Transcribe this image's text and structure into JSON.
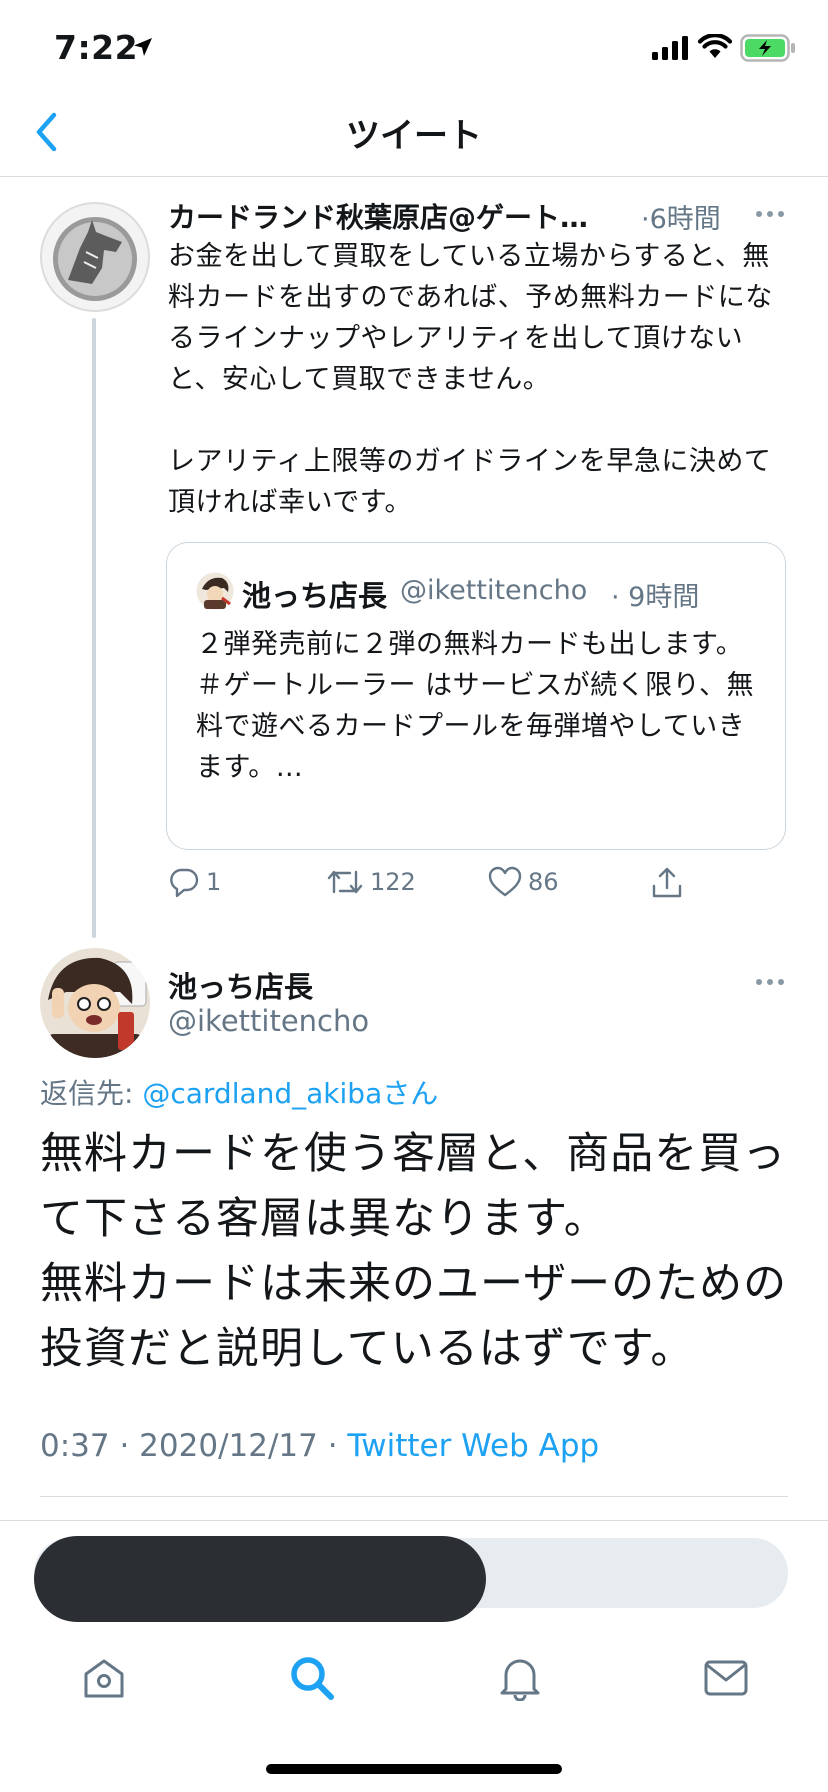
{
  "status_bar": {
    "time": "7:22"
  },
  "nav": {
    "title": "ツイート"
  },
  "parent_tweet": {
    "name": "カードランド秋葉原店@ゲート…",
    "time": "·6時間",
    "text": "お金を出して買取をしている立場からすると、無料カードを出すのであれば、予め無料カードになるラインナップやレアリティを出して頂けないと、安心して買取できません。\n\nレアリティ上限等のガイドラインを早急に決めて頂ければ幸いです。",
    "quote": {
      "name": "池っち店長",
      "handle": "@ikettitencho",
      "time": "· 9時間",
      "text": "２弾発売前に２弾の無料カードも出します。\n＃ゲートルーラー はサービスが続く限り、無料で遊べるカードプールを毎弾増やしていきます。…"
    },
    "actions": {
      "replies": "1",
      "retweets": "122",
      "likes": "86"
    }
  },
  "main_tweet": {
    "name": "池っち店長",
    "handle": "@ikettitencho",
    "reply_prefix": "返信先: ",
    "reply_to": "@cardland_akibaさん",
    "text": "無料カードを使う客層と、商品を買って下さる客層は異なります。\n無料カードは未来のユーザーのための投資だと説明しているはずです。",
    "timestamp": "0:37 · 2020/12/17 · ",
    "source": "Twitter Web App"
  },
  "colors": {
    "accent": "#1da1f2",
    "secondary_text": "#657786",
    "battery": "#4cd964"
  },
  "icons": [
    "location-arrow-icon",
    "signal-icon",
    "wifi-icon",
    "battery-icon",
    "back-chevron-icon",
    "more-icon",
    "reply-icon",
    "retweet-icon",
    "like-icon",
    "share-icon",
    "home-icon",
    "search-icon",
    "notifications-icon",
    "messages-icon"
  ]
}
